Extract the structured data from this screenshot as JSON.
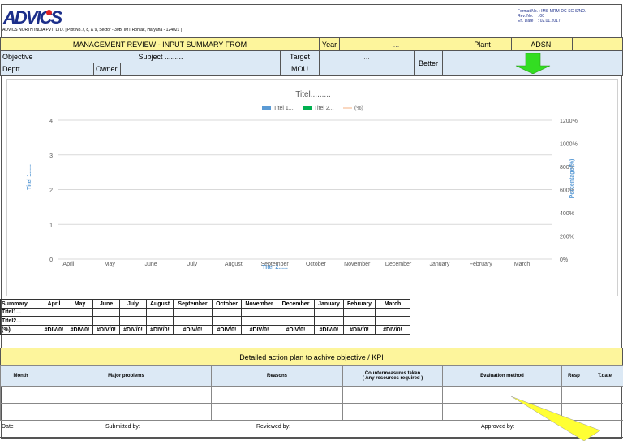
{
  "header": {
    "logo_text": "ADVICS",
    "company": "ADVICS NORTH INDIA PVT. LTD.",
    "address": "Plot No.7, 8, & 9, Sector - 30B, IMT Rohtak, Haryana - 124021",
    "format_no": "Format No. : IMS-MRM-DC-SC-S/NO.",
    "rev_no": "Rev. No.    : 00",
    "eff_date": "Eff. Date    : 02.01.2017"
  },
  "title_row": {
    "title": "MANAGEMENT REVIEW - INPUT SUMMARY FROM",
    "year_label": "Year",
    "year_value": "...",
    "plant_label": "Plant",
    "plant_value": "ADSNI"
  },
  "info": {
    "objective_label": "Objective",
    "subject": "Subject .........",
    "target_label": "Target",
    "target_value": "...",
    "better_label": "Better",
    "deptt_label": "Deptt.",
    "deptt_value": ".....",
    "owner_label": "Owner",
    "owner_value": ".....",
    "mou_label": "MOU",
    "mou_value": "...",
    "better_arrow": "arrow-down-icon",
    "arrow_color": "#33dd22"
  },
  "chart_data": {
    "type": "bar",
    "title": "Titel.........",
    "categories": [
      "April",
      "May",
      "June",
      "July",
      "August",
      "September",
      "October",
      "November",
      "December",
      "January",
      "February",
      "March"
    ],
    "series": [
      {
        "name": "Titel 1...",
        "color": "#5b9bd5",
        "values": []
      },
      {
        "name": "Titel 2...",
        "color": "#00b050",
        "values": []
      },
      {
        "name": "(%)",
        "color": "#f4b183",
        "values": []
      }
    ],
    "xlabel": "Titel 2......",
    "ylabel": "Titel 1......",
    "y2label": "Percentage(%)",
    "ylim": [
      0,
      4
    ],
    "yticks": [
      "0",
      "1",
      "2",
      "3",
      "4"
    ],
    "y2lim": [
      0,
      1200
    ],
    "y2ticks": [
      "0%",
      "200%",
      "400%",
      "600%",
      "800%",
      "1000%",
      "1200%"
    ],
    "grid": true,
    "legend": "top"
  },
  "summary": {
    "headers": [
      "Summary",
      "April",
      "May",
      "June",
      "July",
      "August",
      "September",
      "October",
      "November",
      "December",
      "January",
      "February",
      "March"
    ],
    "rows": [
      [
        "Titel1...",
        "",
        "",
        "",
        "",
        "",
        "",
        "",
        "",
        "",
        "",
        "",
        ""
      ],
      [
        "Titel2...",
        "",
        "",
        "",
        "",
        "",
        "",
        "",
        "",
        "",
        "",
        "",
        ""
      ],
      [
        "(%)",
        "#DIV/0!",
        "#DIV/0!",
        "#DIV/0!",
        "#DIV/0!",
        "#DIV/0!",
        "#DIV/0!",
        "#DIV/0!",
        "#DIV/0!",
        "#DIV/0!",
        "#DIV/0!",
        "#DIV/0!",
        "#DIV/0!"
      ]
    ]
  },
  "action_plan": {
    "title": "Detailed action plan to achive objective / KPI",
    "headers": [
      "Month",
      "Major problems",
      "Reasons",
      "Countermeasures taken\n( Any resources required )",
      "Evaluation method",
      "Resp",
      "T.date"
    ]
  },
  "footer": {
    "date": "Date",
    "submitted": "Submitted by:",
    "reviewed": "Reviewed by:",
    "approved": "Approved by:"
  }
}
